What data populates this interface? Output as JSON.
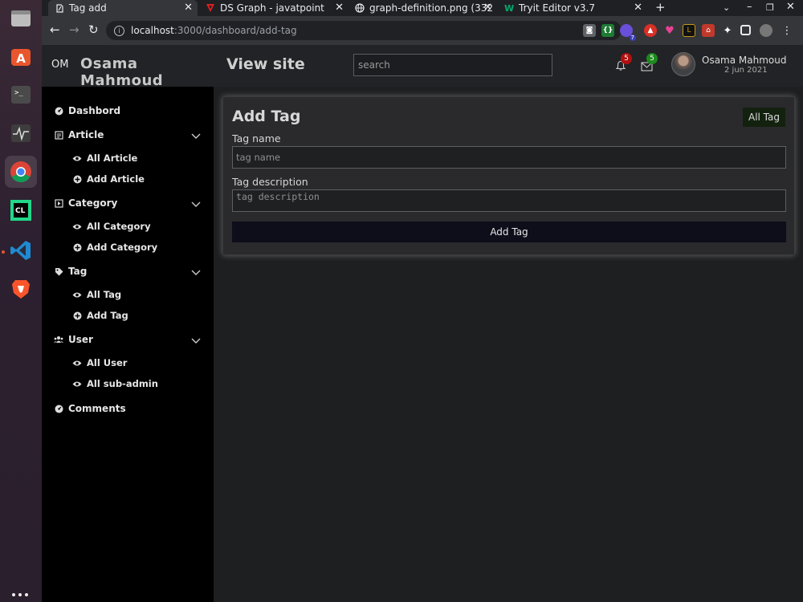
{
  "browser": {
    "tabs": [
      {
        "title": "Tag add",
        "active": true
      },
      {
        "title": "DS Graph - javatpoint",
        "active": false
      },
      {
        "title": "graph-definition.png (332",
        "active": false
      },
      {
        "title": "Tryit Editor v3.7",
        "active": false
      }
    ],
    "url_host": "localhost",
    "url_path": ":3000/dashboard/add-tag",
    "extension_badge": "7"
  },
  "brand": {
    "initials": "OM",
    "name": "Osama Mahmoud"
  },
  "header": {
    "view_site": "View site",
    "search_placeholder": "search",
    "notifications_count": "5",
    "messages_count": "5",
    "user_name": "Osama Mahmoud",
    "user_date": "2 jun 2021"
  },
  "sidebar": {
    "dashboard": "Dashbord",
    "article": "Article",
    "all_article": "All Article",
    "add_article": "Add Article",
    "category": "Category",
    "all_category": "All Category",
    "add_category": "Add Category",
    "tag": "Tag",
    "all_tag": "All Tag",
    "add_tag": "Add Tag",
    "user": "User",
    "all_user": "All User",
    "all_subadmin": "All sub-admin",
    "comments": "Comments"
  },
  "form": {
    "title": "Add Tag",
    "all_tag_button": "All Tag",
    "name_label": "Tag name",
    "name_placeholder": "tag name",
    "desc_label": "Tag description",
    "desc_placeholder": "tag description",
    "submit_label": "Add Tag"
  },
  "colors": {
    "notification_badge": "#b30f0f",
    "message_badge": "#1c8a1c",
    "sidebar_bg": "#000000",
    "topbar_bg": "#222326"
  }
}
